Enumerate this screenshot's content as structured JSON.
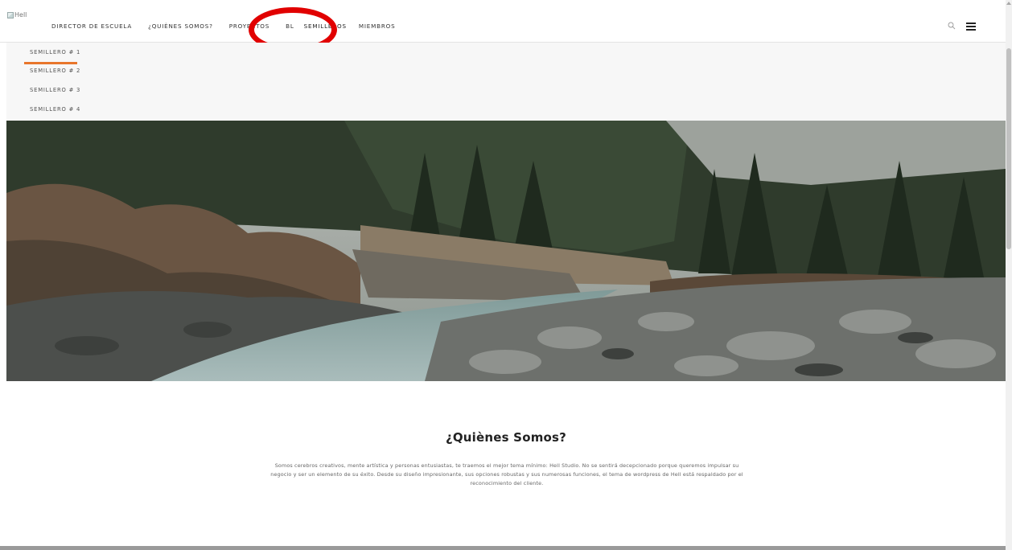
{
  "header": {
    "logo_alt": "Hell",
    "nav": [
      "DIRECTOR DE ESCUELA",
      "¿QUIÈNES SOMOS?",
      "PROYECTOS",
      "BL",
      "SEMILLEROS",
      "MIEMBROS"
    ],
    "icons": [
      "search-icon",
      "hamburger-menu-icon"
    ]
  },
  "dropdown": {
    "items": [
      "SEMILLERO # 1",
      "SEMILLERO # 2",
      "SEMILLERO # 3",
      "SEMILLERO # 4"
    ],
    "accent_color": "#e8762c"
  },
  "about": {
    "title": "¿Quiènes Somos?",
    "text": "Somos cerebros creativos, mente artística y personas entusiastas, te traemos el mejor tema mínimo: Hell Studio. No se sentirá decepcionado porque queremos impulsar su negocio y ser un elemento de su éxito. Desde su diseño impresionante, sus opciones robustas y sus numerosas funciones, el tema de wordpress de Hell está respaldado por el reconocimiento del cliente."
  },
  "annotation": {
    "color": "#e10000"
  }
}
